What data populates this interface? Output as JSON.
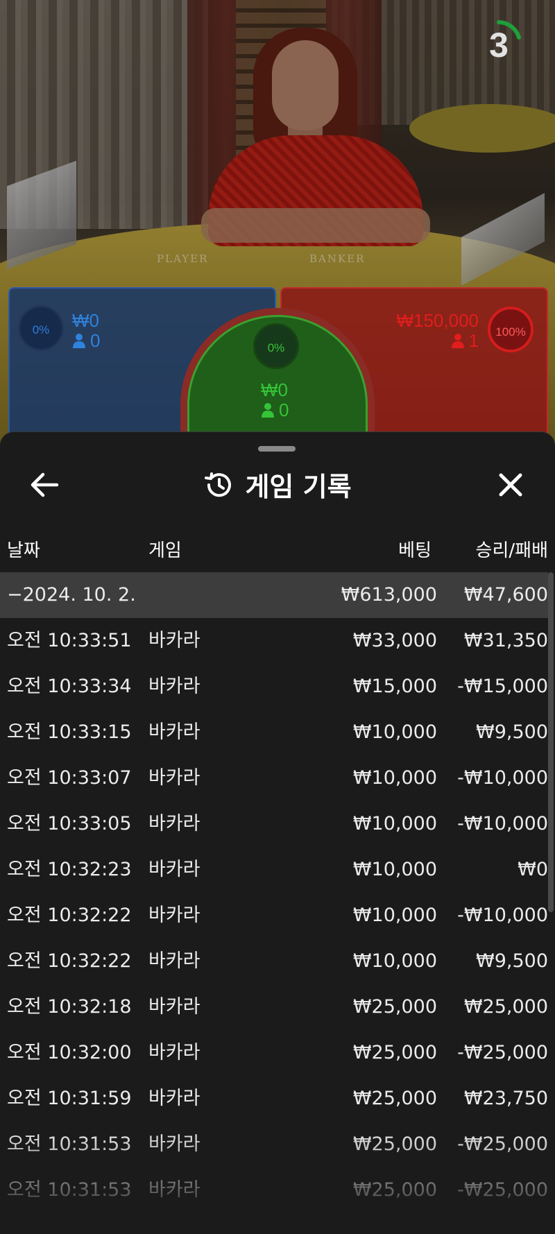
{
  "scene": {
    "table_labels": {
      "player": "PLAYER",
      "banker": "BANKER"
    },
    "countdown": "3"
  },
  "bets": {
    "player": {
      "percent": "0%",
      "amount": "₩0",
      "players": "0"
    },
    "tie": {
      "percent": "0%",
      "amount": "₩0",
      "players": "0"
    },
    "banker": {
      "percent": "100%",
      "amount": "₩150,000",
      "players": "1"
    }
  },
  "history": {
    "title": "게임 기록",
    "columns": {
      "date": "날짜",
      "game": "게임",
      "bet": "베팅",
      "result": "승리/패배"
    },
    "day": {
      "label": "−2024. 10. 2.",
      "bet_total": "₩613,000",
      "result_total": "₩47,600"
    },
    "rows": [
      {
        "time": "오전 10:33:51",
        "game": "바카라",
        "bet": "₩33,000",
        "result": "₩31,350"
      },
      {
        "time": "오전 10:33:34",
        "game": "바카라",
        "bet": "₩15,000",
        "result": "-₩15,000"
      },
      {
        "time": "오전 10:33:15",
        "game": "바카라",
        "bet": "₩10,000",
        "result": "₩9,500"
      },
      {
        "time": "오전 10:33:07",
        "game": "바카라",
        "bet": "₩10,000",
        "result": "-₩10,000"
      },
      {
        "time": "오전 10:33:05",
        "game": "바카라",
        "bet": "₩10,000",
        "result": "-₩10,000"
      },
      {
        "time": "오전 10:32:23",
        "game": "바카라",
        "bet": "₩10,000",
        "result": "₩0"
      },
      {
        "time": "오전 10:32:22",
        "game": "바카라",
        "bet": "₩10,000",
        "result": "-₩10,000"
      },
      {
        "time": "오전 10:32:22",
        "game": "바카라",
        "bet": "₩10,000",
        "result": "₩9,500"
      },
      {
        "time": "오전 10:32:18",
        "game": "바카라",
        "bet": "₩25,000",
        "result": "₩25,000"
      },
      {
        "time": "오전 10:32:00",
        "game": "바카라",
        "bet": "₩25,000",
        "result": "-₩25,000"
      },
      {
        "time": "오전 10:31:59",
        "game": "바카라",
        "bet": "₩25,000",
        "result": "₩23,750"
      },
      {
        "time": "오전 10:31:53",
        "game": "바카라",
        "bet": "₩25,000",
        "result": "-₩25,000"
      },
      {
        "time": "오전 10:31:53",
        "game": "바카라",
        "bet": "₩25,000",
        "result": "-₩25,000"
      }
    ]
  },
  "icons": {
    "back": "arrow-left-icon",
    "history": "history-clock-icon",
    "close": "close-icon",
    "person": "person-icon"
  },
  "colors": {
    "player": "#2f82dd",
    "tie": "#35c437",
    "banker": "#e21d1d",
    "panel": "#1b1b1b",
    "day_row": "#3d3d3d"
  }
}
